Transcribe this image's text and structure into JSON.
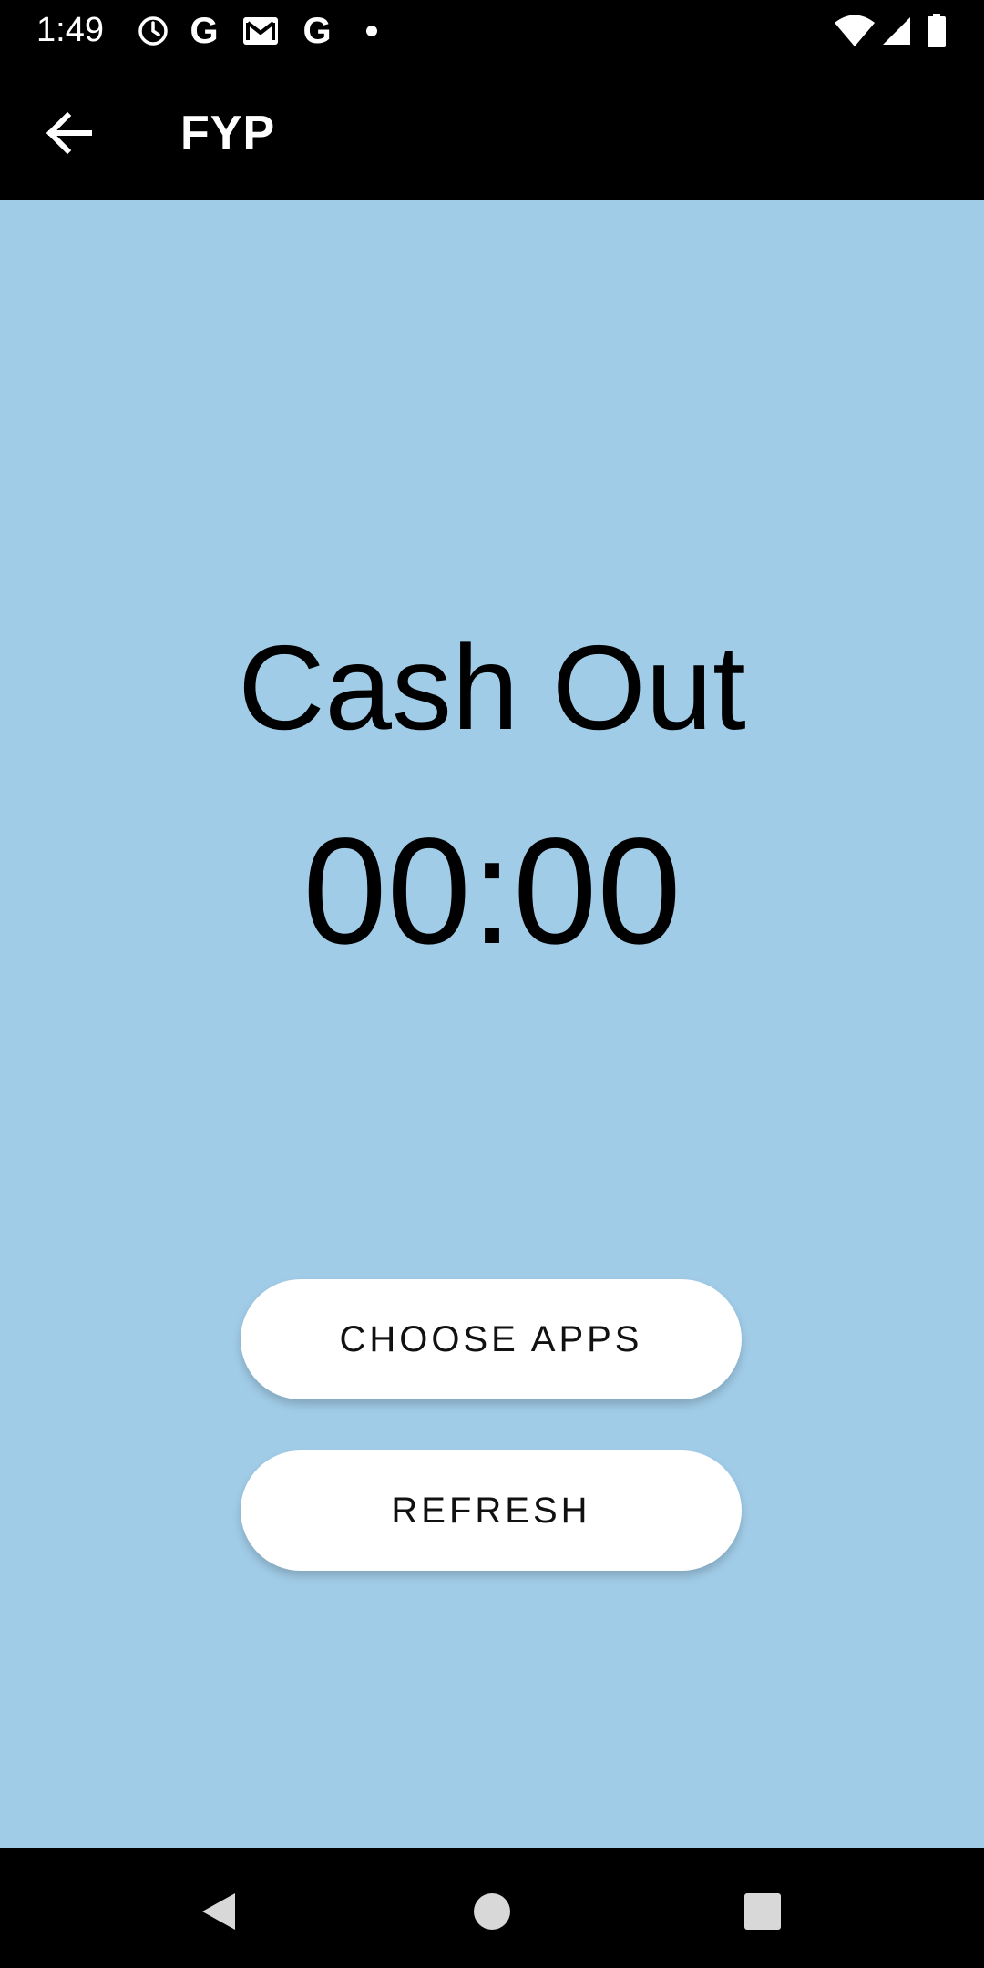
{
  "status_bar": {
    "time": "1:49",
    "icons": [
      "alarm-icon",
      "google-icon",
      "gmail-icon",
      "google-icon",
      "notification-dot-icon",
      "wifi-icon",
      "signal-icon",
      "battery-icon"
    ],
    "google_letter": "G"
  },
  "app_bar": {
    "title": "FYP",
    "back_icon": "arrow-left-icon"
  },
  "main": {
    "heading": "Cash Out",
    "timer": "00:00",
    "choose_apps_label": "CHOOSE APPS",
    "refresh_label": "REFRESH"
  },
  "nav_bar": {
    "icons": [
      "back-triangle-icon",
      "home-circle-icon",
      "recents-square-icon"
    ]
  },
  "colors": {
    "background": "#a1cce8",
    "bars": "#000000",
    "button": "#ffffff",
    "text": "#000000"
  }
}
